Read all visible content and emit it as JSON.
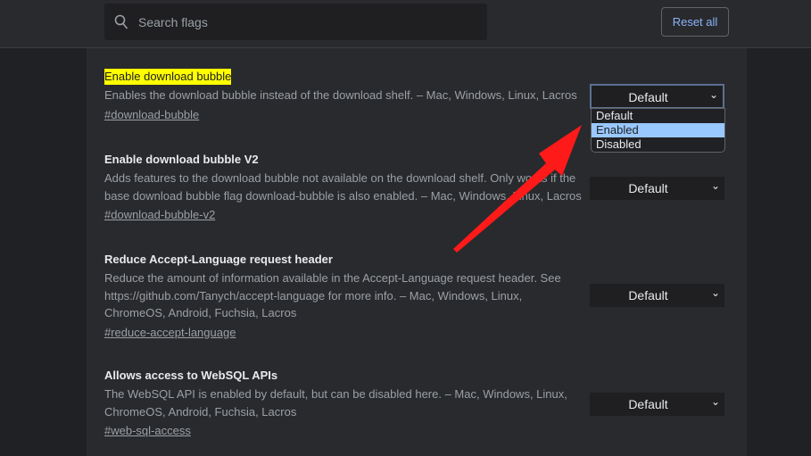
{
  "header": {
    "search_placeholder": "Search flags",
    "reset_label": "Reset all"
  },
  "flags": [
    {
      "title": "Enable download bubble",
      "desc": "Enables the download bubble instead of the download shelf. – Mac, Windows, Linux, Lacros",
      "link": "#download-bubble",
      "value": "Default"
    },
    {
      "title": "Enable download bubble V2",
      "desc": "Adds features to the download bubble not available on the download shelf. Only works if the base download bubble flag download-bubble is also enabled. – Mac, Windows, Linux, Lacros",
      "link": "#download-bubble-v2",
      "value": "Default"
    },
    {
      "title": "Reduce Accept-Language request header",
      "desc": "Reduce the amount of information available in the Accept-Language request header. See https://github.com/Tanych/accept-language for more info. – Mac, Windows, Linux, ChromeOS, Android, Fuchsia, Lacros",
      "link": "#reduce-accept-language",
      "value": "Default"
    },
    {
      "title": "Allows access to WebSQL APIs",
      "desc": "The WebSQL API is enabled by default, but can be disabled here. – Mac, Windows, Linux, ChromeOS, Android, Fuchsia, Lacros",
      "link": "#web-sql-access",
      "value": "Default"
    }
  ],
  "dropdown": {
    "options": [
      "Default",
      "Enabled",
      "Disabled"
    ],
    "highlighted": "Enabled"
  },
  "colors": {
    "highlight": "#ffff00",
    "arrow": "#ff0000",
    "accent": "#8ab4f8"
  },
  "icons": {
    "search": "search-icon",
    "chevron": "chevron-down-icon"
  }
}
